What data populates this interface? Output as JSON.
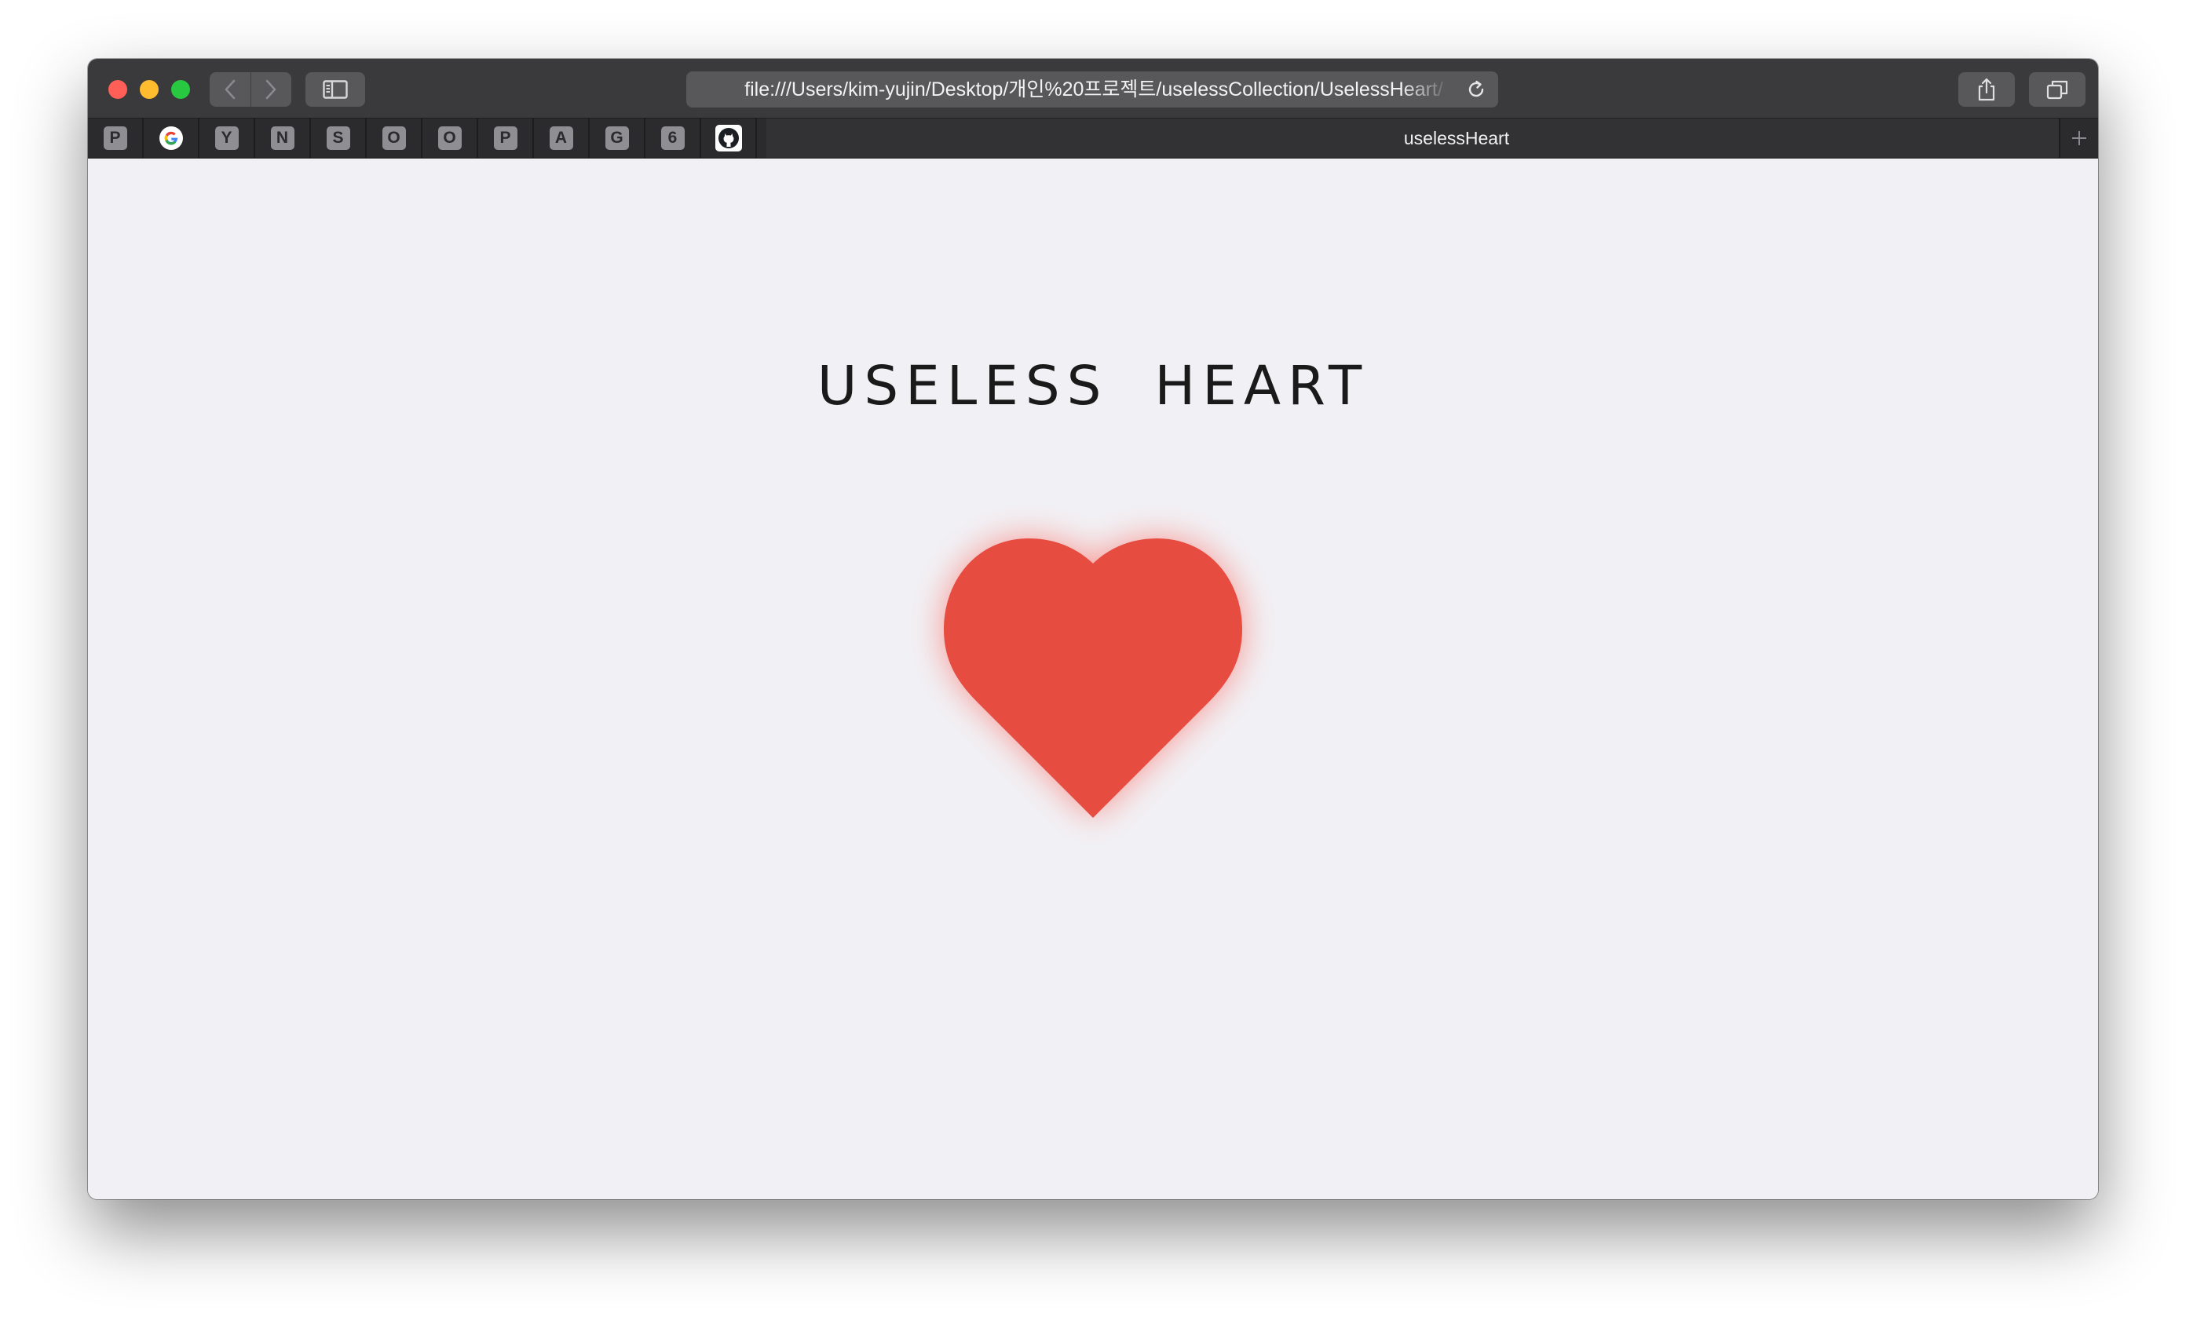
{
  "browser": {
    "url": "file:///Users/kim-yujin/Desktop/개인%20프로젝트/uselessCollection/UselessHeart/",
    "active_tab_title": "uselessHeart",
    "pinned_tabs": [
      {
        "label": "P",
        "icon": "badge"
      },
      {
        "label": "",
        "icon": "google-icon"
      },
      {
        "label": "Y",
        "icon": "badge"
      },
      {
        "label": "N",
        "icon": "badge"
      },
      {
        "label": "S",
        "icon": "badge"
      },
      {
        "label": "O",
        "icon": "badge"
      },
      {
        "label": "O",
        "icon": "badge"
      },
      {
        "label": "P",
        "icon": "badge"
      },
      {
        "label": "A",
        "icon": "badge"
      },
      {
        "label": "G",
        "icon": "badge"
      },
      {
        "label": "6",
        "icon": "badge"
      },
      {
        "label": "",
        "icon": "github-icon"
      }
    ]
  },
  "page": {
    "title": "USELESS HEART",
    "heart_color": "#e64c40",
    "glow_color": "#ff4a3d",
    "background_color": "#f1f1f5"
  }
}
